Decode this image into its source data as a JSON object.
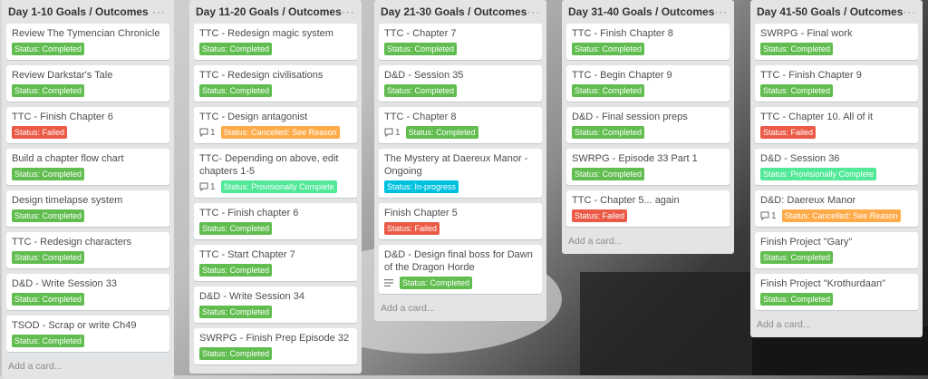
{
  "board": {
    "add_card_label": "Add a card...",
    "lists": [
      {
        "title": "Day 1-10 Goals / Outcomes",
        "cards": [
          {
            "title": "Review The Tymencian Chronicle",
            "status": "Status: Completed"
          },
          {
            "title": "Review Darkstar's Tale",
            "status": "Status: Completed"
          },
          {
            "title": "TTC - Finish Chapter 6",
            "status": "Status: Failed"
          },
          {
            "title": "Build a chapter flow chart",
            "status": "Status: Completed"
          },
          {
            "title": "Design timelapse system",
            "status": "Status: Completed"
          },
          {
            "title": "TTC - Redesign characters",
            "status": "Status: Completed"
          },
          {
            "title": "D&D - Write Session 33",
            "status": "Status: Completed"
          },
          {
            "title": "TSOD - Scrap or write Ch49",
            "status": "Status: Completed"
          }
        ]
      },
      {
        "title": "Day 11-20 Goals / Outcomes",
        "cards": [
          {
            "title": "TTC - Redesign magic system",
            "status": "Status: Completed"
          },
          {
            "title": "TTC - Redesign civilisations",
            "status": "Status: Completed"
          },
          {
            "title": "TTC - Design antagonist",
            "comments": "1",
            "status": "Status: Cancelled: See Reason"
          },
          {
            "title": "TTC- Depending on above, edit chapters 1-5",
            "comments": "1",
            "status": "Status: Provisionally Complete"
          },
          {
            "title": "TTC - Finish chapter 6",
            "status": "Status: Completed"
          },
          {
            "title": "TTC - Start Chapter 7",
            "status": "Status: Completed"
          },
          {
            "title": "D&D - Write Session 34",
            "status": "Status: Completed"
          },
          {
            "title": "SWRPG - Finish Prep Episode 32",
            "status": "Status: Completed"
          }
        ]
      },
      {
        "title": "Day 21-30 Goals / Outcomes",
        "cards": [
          {
            "title": "TTC - Chapter 7",
            "status": "Status: Completed"
          },
          {
            "title": "D&D - Session 35",
            "status": "Status: Completed"
          },
          {
            "title": "TTC - Chapter 8",
            "comments": "1",
            "status": "Status: Completed"
          },
          {
            "title": "The Mystery at Daereux Manor - Ongoing",
            "status": "Status: In-progress"
          },
          {
            "title": "Finish Chapter 5",
            "status": "Status: Failed"
          },
          {
            "title": "D&D - Design final boss for Dawn of the Dragon Horde",
            "has_description": true,
            "status": "Status: Completed"
          }
        ]
      },
      {
        "title": "Day 31-40 Goals / Outcomes",
        "cards": [
          {
            "title": "TTC - Finish Chapter 8",
            "status": "Status: Completed"
          },
          {
            "title": "TTC - Begin Chapter 9",
            "status": "Status: Completed"
          },
          {
            "title": "D&D - Final session preps",
            "status": "Status: Completed"
          },
          {
            "title": "SWRPG - Episode 33 Part 1",
            "status": "Status: Completed"
          },
          {
            "title": "TTC - Chapter 5... again",
            "status": "Status: Failed"
          }
        ]
      },
      {
        "title": "Day 41-50 Goals / Outcomes",
        "cards": [
          {
            "title": "SWRPG - Final work",
            "status": "Status: Completed"
          },
          {
            "title": "TTC - Finish Chapter 9",
            "status": "Status: Completed"
          },
          {
            "title": "TTC - Chapter 10. All of it",
            "status": "Status: Failed"
          },
          {
            "title": "D&D - Session 36",
            "status": "Status: Provisionally Complete"
          },
          {
            "title": "D&D: Daereux Manor",
            "comments": "1",
            "status": "Status: Cancelled: See Reason"
          },
          {
            "title": "Finish Project \"Gary\"",
            "status": "Status: Completed"
          },
          {
            "title": "Finish Project \"Krothurdaan\"",
            "status": "Status: Completed"
          }
        ]
      }
    ]
  },
  "colors": {
    "completed": "#61bd4f",
    "failed": "#eb5a46",
    "cancelled": "#ffab4a",
    "provisional": "#51e898",
    "in_progress": "#00c2e0",
    "list_bg": "#e2e4e6"
  }
}
